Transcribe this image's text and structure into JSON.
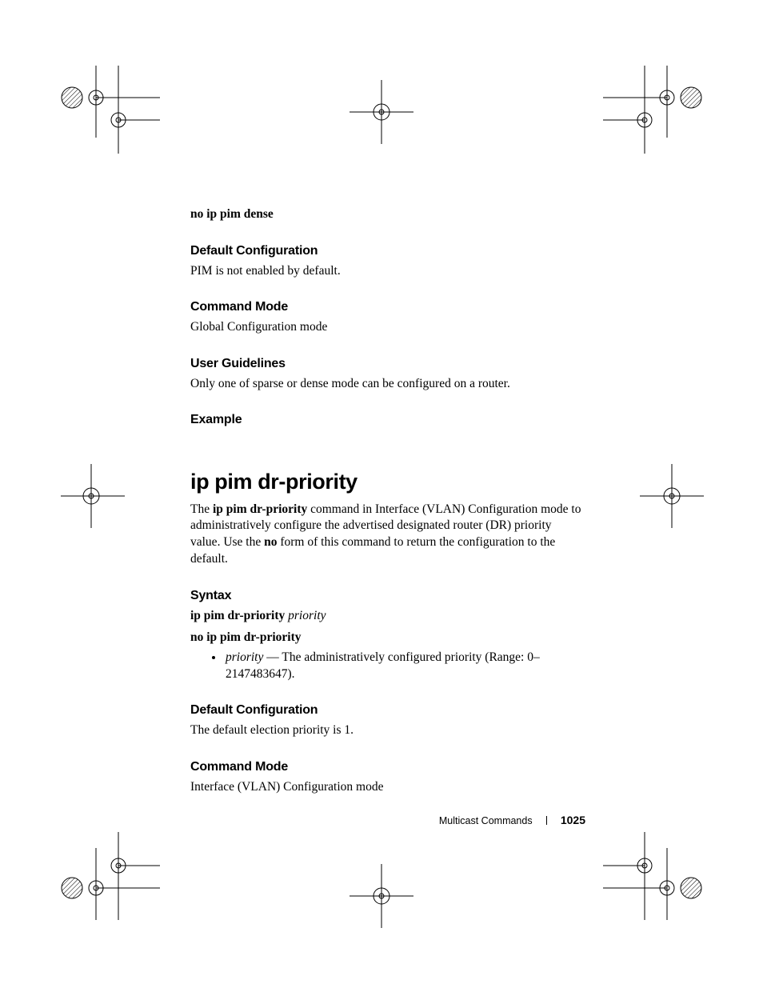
{
  "line_no_dense": "no ip pim dense",
  "sec1": {
    "heading_default_config": "Default Configuration",
    "text_default_config": "PIM is not enabled by default.",
    "heading_command_mode": "Command Mode",
    "text_command_mode": "Global Configuration mode",
    "heading_user_guidelines": "User Guidelines",
    "text_user_guidelines": "Only one of sparse or dense mode can be configured on a router.",
    "heading_example": "Example"
  },
  "command_title": "ip pim dr-priority",
  "desc": {
    "prefix": "The ",
    "bold_cmd": "ip pim dr-priority",
    "mid1": " command in Interface (VLAN) Configuration mode to administratively configure the advertised designated router (DR) priority value. Use the ",
    "bold_no": "no",
    "mid2": " form of this command to return the configuration to the default."
  },
  "syntax": {
    "heading": "Syntax",
    "line1_bold": "ip pim dr-priority",
    "line1_italic": " priority",
    "line2_bold": "no ip pim dr-priority",
    "bullet_param": "priority",
    "bullet_rest": " — The administratively configured priority (Range: 0–2147483647)."
  },
  "sec2": {
    "heading_default_config": "Default Configuration",
    "text_default_config": "The default election priority is 1.",
    "heading_command_mode": "Command Mode",
    "text_command_mode": "Interface (VLAN) Configuration mode"
  },
  "footer": {
    "section": "Multicast Commands",
    "page": "1025"
  }
}
